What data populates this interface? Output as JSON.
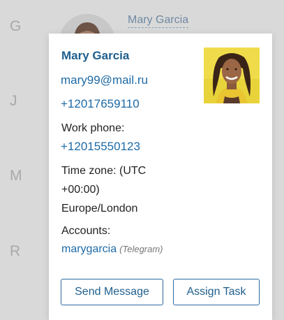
{
  "background": {
    "letters": [
      "G",
      "J",
      "M",
      "R"
    ],
    "contact_name": "Mary Garcia"
  },
  "card": {
    "name": "Mary Garcia",
    "email": "mary99@mail.ru",
    "phone": "+12017659110",
    "work_phone_label": "Work phone:",
    "work_phone": "+12015550123",
    "timezone_line1": "Time zone: (UTC",
    "timezone_line2": "+00:00)",
    "timezone_line3": "Europe/London",
    "accounts_label": "Accounts:",
    "account_name": "marygarcia",
    "account_type": "(Telegram)",
    "send_message_label": "Send Message",
    "assign_task_label": "Assign Task"
  },
  "colors": {
    "accent": "#1e6aa6",
    "photo_background": "#e8d33a"
  }
}
